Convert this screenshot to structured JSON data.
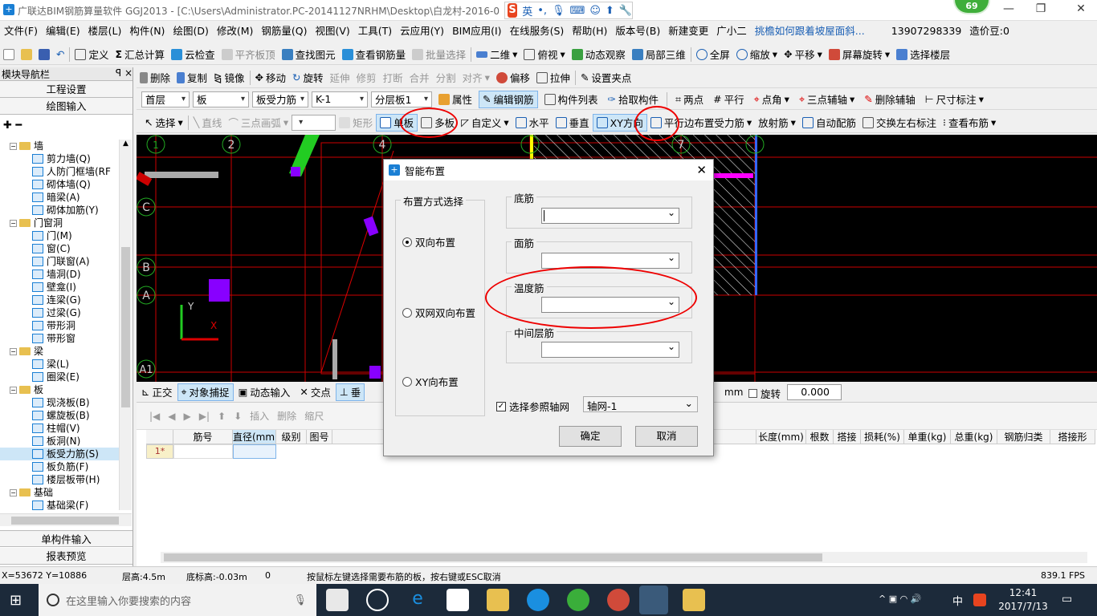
{
  "titlebar": {
    "title": "广联达BIM钢筋算量软件 GGJ2013 - [C:\\Users\\Administrator.PC-20141127NRHM\\Desktop\\白龙村-2016-08-",
    "ime_lang": "英",
    "badge": "69"
  },
  "menu": [
    "文件(F)",
    "编辑(E)",
    "楼层(L)",
    "构件(N)",
    "绘图(D)",
    "修改(M)",
    "钢筋量(Q)",
    "视图(V)",
    "工具(T)",
    "云应用(Y)",
    "BIM应用(I)",
    "在线服务(S)",
    "帮助(H)",
    "版本号(B)",
    "新建变更",
    "广小二",
    "挑檐如何跟着坡屋面斜...",
    "13907298339",
    "造价豆:0"
  ],
  "toolbar1": [
    "定义",
    "汇总计算",
    "云检查",
    "平齐板顶",
    "查找图元",
    "查看钢筋量",
    "批量选择",
    "二维",
    "俯视",
    "动态观察",
    "局部三维",
    "全屏",
    "缩放",
    "平移",
    "屏幕旋转",
    "选择楼层"
  ],
  "toolbar2": [
    "删除",
    "复制",
    "镜像",
    "移动",
    "旋转",
    "延伸",
    "修剪",
    "打断",
    "合并",
    "分割",
    "对齐",
    "偏移",
    "拉伸",
    "设置夹点"
  ],
  "toolbar3": {
    "floor": "首层",
    "type": "板",
    "subtype": "板受力筋",
    "name": "K-1",
    "layer": "分层板1",
    "items": [
      "属性",
      "编辑钢筋",
      "构件列表",
      "拾取构件",
      "两点",
      "平行",
      "点角",
      "三点辅轴",
      "删除辅轴",
      "尺寸标注"
    ]
  },
  "toolbar4": [
    "选择",
    "直线",
    "三点画弧",
    "矩形",
    "单板",
    "多板",
    "自定义",
    "水平",
    "垂直",
    "XY方向",
    "平行边布置受力筋",
    "放射筋",
    "自动配筋",
    "交换左右标注",
    "查看布筋"
  ],
  "leftpanel": {
    "header": "模块导航栏",
    "pin": "ꟼ ×",
    "btn1": "工程设置",
    "btn2": "绘图输入",
    "btn3": "单构件输入",
    "btn4": "报表预览"
  },
  "tree": [
    {
      "lvl": 0,
      "t": "墙",
      "f": true
    },
    {
      "lvl": 1,
      "t": "剪力墙(Q)"
    },
    {
      "lvl": 1,
      "t": "人防门框墙(RF"
    },
    {
      "lvl": 1,
      "t": "砌体墙(Q)"
    },
    {
      "lvl": 1,
      "t": "暗梁(A)"
    },
    {
      "lvl": 1,
      "t": "砌体加筋(Y)"
    },
    {
      "lvl": 0,
      "t": "门窗洞",
      "f": true
    },
    {
      "lvl": 1,
      "t": "门(M)"
    },
    {
      "lvl": 1,
      "t": "窗(C)"
    },
    {
      "lvl": 1,
      "t": "门联窗(A)"
    },
    {
      "lvl": 1,
      "t": "墙洞(D)"
    },
    {
      "lvl": 1,
      "t": "壁龛(I)"
    },
    {
      "lvl": 1,
      "t": "连梁(G)"
    },
    {
      "lvl": 1,
      "t": "过梁(G)"
    },
    {
      "lvl": 1,
      "t": "带形洞"
    },
    {
      "lvl": 1,
      "t": "带形窗"
    },
    {
      "lvl": 0,
      "t": "梁",
      "f": true
    },
    {
      "lvl": 1,
      "t": "梁(L)"
    },
    {
      "lvl": 1,
      "t": "圈梁(E)"
    },
    {
      "lvl": 0,
      "t": "板",
      "f": true
    },
    {
      "lvl": 1,
      "t": "现浇板(B)"
    },
    {
      "lvl": 1,
      "t": "螺旋板(B)"
    },
    {
      "lvl": 1,
      "t": "柱帽(V)"
    },
    {
      "lvl": 1,
      "t": "板洞(N)"
    },
    {
      "lvl": 1,
      "t": "板受力筋(S)",
      "sel": true
    },
    {
      "lvl": 1,
      "t": "板负筋(F)"
    },
    {
      "lvl": 1,
      "t": "楼层板带(H)"
    },
    {
      "lvl": 0,
      "t": "基础",
      "f": true
    },
    {
      "lvl": 1,
      "t": "基础梁(F)"
    }
  ],
  "canvas": {
    "axes_top": [
      "1",
      "2",
      "4",
      "7"
    ],
    "axes_left": [
      "C",
      "B",
      "A",
      "A1"
    ],
    "y": "Y",
    "x": "X"
  },
  "bottombar": {
    "items": [
      "正交",
      "对象捕捉",
      "动态输入",
      "交点",
      "垂"
    ],
    "unit": "mm",
    "rotate": "旋转",
    "rotate_val": "0.000"
  },
  "grid": {
    "toolbar": [
      "插入",
      "删除",
      "缩尺"
    ],
    "columns": [
      "",
      "筋号",
      "直径(mm)",
      "级别",
      "图号",
      "",
      "长度(mm)",
      "根数",
      "搭接",
      "损耗(%)",
      "单重(kg)",
      "总重(kg)",
      "钢筋归类",
      "搭接形"
    ],
    "row1": "1*"
  },
  "dialog": {
    "title": "智能布置",
    "group_left": "布置方式选择",
    "options": [
      "双向布置",
      "双网双向布置",
      "XY向布置"
    ],
    "fields": [
      "底筋",
      "面筋",
      "温度筋",
      "中间层筋"
    ],
    "checkbox": "选择参照轴网",
    "axis_select": "轴网-1",
    "ok": "确定",
    "cancel": "取消"
  },
  "status": {
    "coords": "X=53672 Y=10886",
    "floor_h": "层高:4.5m",
    "bottom_h": "底标高:-0.03m",
    "zero": "0",
    "hint": "按鼠标左键选择需要布筋的板，按右键或ESC取消",
    "fps": "839.1 FPS"
  },
  "taskbar": {
    "search": "在这里输入你要搜索的内容",
    "lang": "中",
    "time": "12:41",
    "date": "2017/7/13"
  }
}
